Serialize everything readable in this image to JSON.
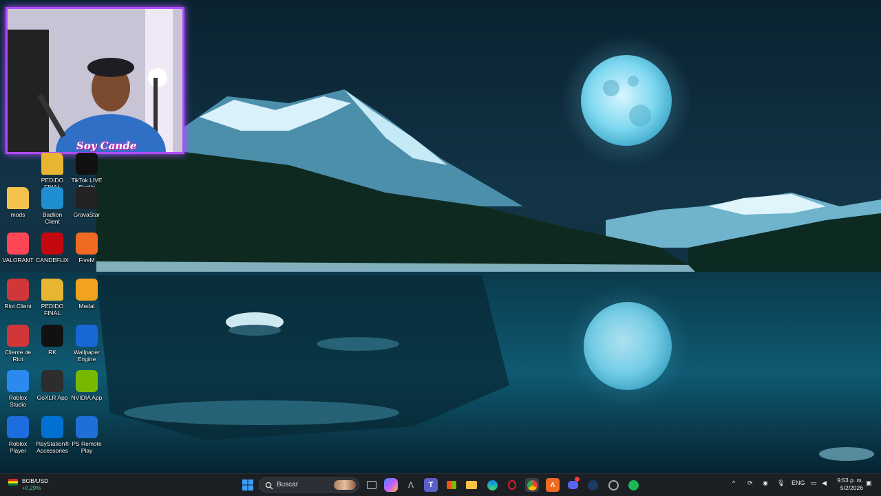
{
  "desktop": {
    "icons": [
      {
        "label": "PEDIDO FINAL",
        "icon": "folder-icon",
        "color": "#e8b530"
      },
      {
        "label": "TikTok LIVE Studio",
        "icon": "tiktok-icon",
        "color": "#111111"
      },
      {
        "label": "mods",
        "icon": "folder-icon",
        "color": "#f3c24a"
      },
      {
        "label": "Badlion Client",
        "icon": "badlion-icon",
        "color": "#1f8fd1"
      },
      {
        "label": "GravaStar",
        "icon": "gravastar-icon",
        "color": "#222222"
      },
      {
        "label": "VALORANT",
        "icon": "valorant-icon",
        "color": "#ff4655"
      },
      {
        "label": "CANDEFLIX",
        "icon": "candeflix-icon",
        "color": "#c40812"
      },
      {
        "label": "FiveM",
        "icon": "fivem-icon",
        "color": "#f06a22"
      },
      {
        "label": "Riot Client",
        "icon": "riot-icon",
        "color": "#d13639"
      },
      {
        "label": "PEDIDO FINAL",
        "icon": "folder-icon",
        "color": "#e8b530"
      },
      {
        "label": "Medal",
        "icon": "medal-icon",
        "color": "#f1a320"
      },
      {
        "label": "Cliente de Riot",
        "icon": "riot-icon",
        "color": "#d13639"
      },
      {
        "label": "RK",
        "icon": "rk-icon",
        "color": "#111111"
      },
      {
        "label": "Wallpaper Engine",
        "icon": "wallpaper-engine-icon",
        "color": "#1767d6"
      },
      {
        "label": "Roblox Studio",
        "icon": "roblox-studio-icon",
        "color": "#2b8af0"
      },
      {
        "label": "GoXLR App",
        "icon": "goxlr-icon",
        "color": "#2d2d2d"
      },
      {
        "label": "NVIDIA App",
        "icon": "nvidia-icon",
        "color": "#76b900"
      },
      {
        "label": "Roblox Player",
        "icon": "roblox-icon",
        "color": "#1d6de0"
      },
      {
        "label": "PlayStation® Accessories",
        "icon": "playstation-icon",
        "color": "#0070d1"
      },
      {
        "label": "PS Remote Play",
        "icon": "ps-remote-play-icon",
        "color": "#1f6fd8"
      }
    ]
  },
  "webcam": {
    "overlay_text": "Soy Cande"
  },
  "taskbar": {
    "widget": {
      "symbol": "BOB/USD",
      "change": "+0,29%"
    },
    "search_placeholder": "Buscar",
    "pinned": [
      "start-icon",
      "search-icon",
      "task-view-icon",
      "copilot-icon",
      "vpn-icon",
      "teams-icon",
      "store-icon",
      "file-explorer-icon",
      "edge-icon",
      "opera-icon",
      "chrome-icon",
      "fivem-icon",
      "discord-icon",
      "steam-icon",
      "riot-icon",
      "spotify-icon"
    ],
    "tray": {
      "language": "ENG",
      "time": "9:53 p. m.",
      "date": "5/2/2026"
    },
    "colors": {
      "accent": "#0078d4",
      "spotify": "#1db954",
      "discord": "#5865f2"
    }
  }
}
